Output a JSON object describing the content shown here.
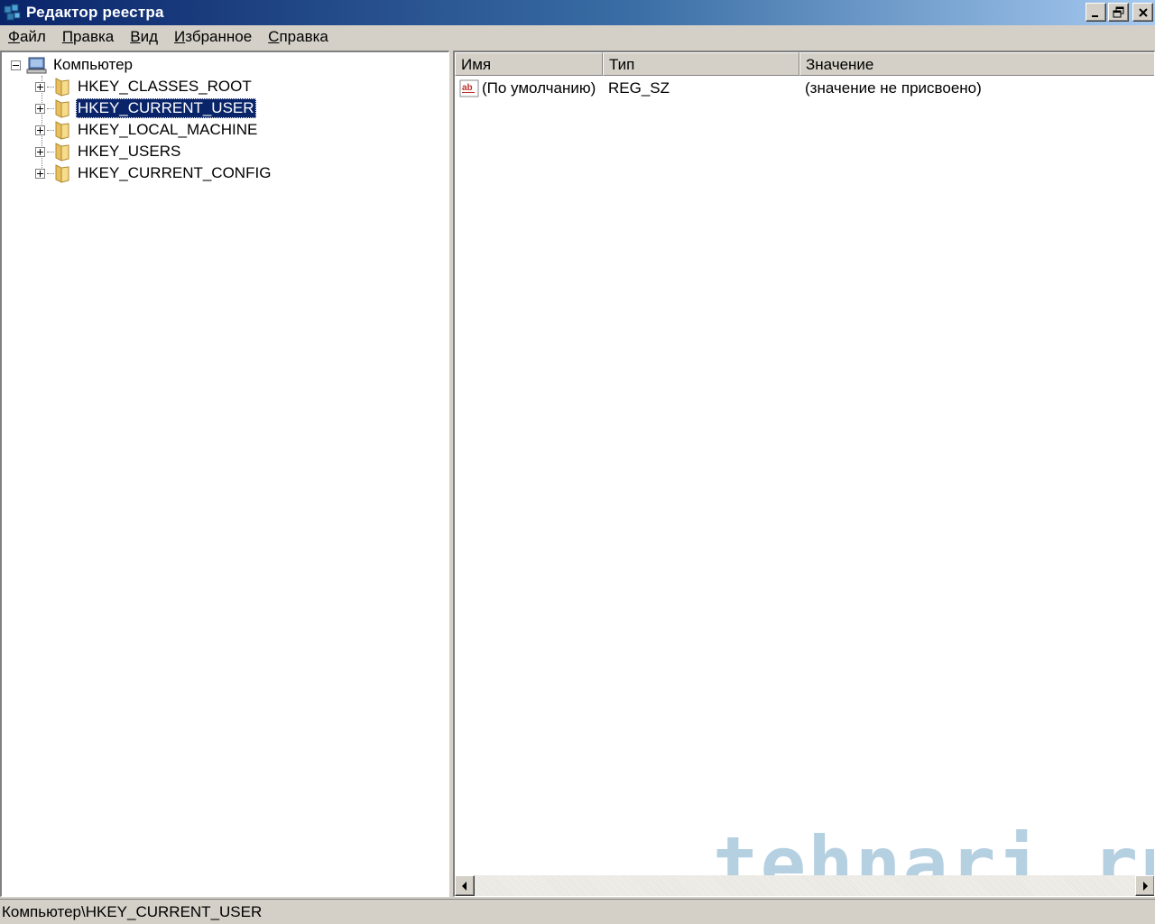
{
  "window": {
    "title": "Редактор реестра",
    "icon": "regedit-icon"
  },
  "menu": {
    "items": [
      {
        "first": "Ф",
        "rest": "айл"
      },
      {
        "first": "П",
        "rest": "равка"
      },
      {
        "first": "В",
        "rest": "ид"
      },
      {
        "first": "И",
        "rest": "збранное"
      },
      {
        "first": "С",
        "rest": "правка"
      }
    ]
  },
  "tree": {
    "root": {
      "label": "Компьютер",
      "icon": "computer-icon",
      "expanded": true
    },
    "keys": [
      {
        "label": "HKEY_CLASSES_ROOT",
        "selected": false
      },
      {
        "label": "HKEY_CURRENT_USER",
        "selected": true
      },
      {
        "label": "HKEY_LOCAL_MACHINE",
        "selected": false
      },
      {
        "label": "HKEY_USERS",
        "selected": false
      },
      {
        "label": "HKEY_CURRENT_CONFIG",
        "selected": false
      }
    ]
  },
  "list": {
    "columns": [
      "Имя",
      "Тип",
      "Значение"
    ],
    "rows": [
      {
        "name": "(По умолчанию)",
        "type": "REG_SZ",
        "value": "(значение не присвоено)",
        "icon": "string-value-icon"
      }
    ]
  },
  "watermark": "tehnari.ru",
  "status": {
    "path": "Компьютер\\HKEY_CURRENT_USER"
  },
  "colors": {
    "selection": "#0a246a",
    "titlebar_start": "#0a246a",
    "titlebar_end": "#a6caf0"
  }
}
